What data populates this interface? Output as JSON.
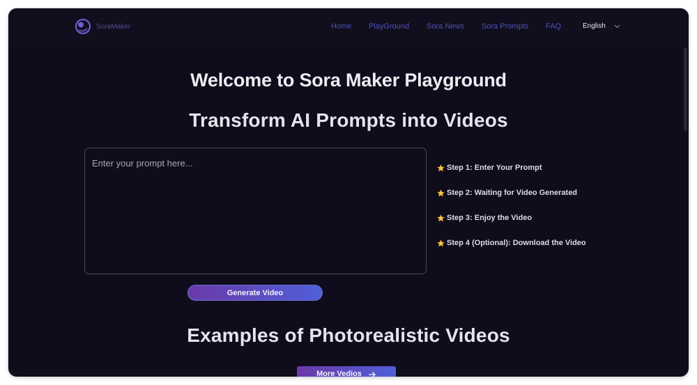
{
  "nav": {
    "logo_text": "SoraMaker",
    "links": [
      "Home",
      "PlayGround",
      "Sora News",
      "Sora Prompts",
      "FAQ"
    ],
    "language": "English"
  },
  "hero": {
    "title": "Welcome to Sora Maker Playground",
    "subtitle": "Transform AI Prompts into Videos"
  },
  "prompt": {
    "placeholder": "Enter your prompt here...",
    "generate_label": "Generate Video"
  },
  "steps": [
    "Step 1: Enter Your Prompt",
    "Step 2: Waiting for Video Generated",
    "Step 3: Enjoy the Video",
    "Step 4 (Optional): Download the Video"
  ],
  "examples": {
    "title": "Examples of Photorealistic Videos",
    "more_label": "More Vedios"
  },
  "icons": {
    "logo": "logo-icon",
    "language_dropdown": "chevron-down-icon",
    "step": "star-icon",
    "more": "arrow-right-icon"
  },
  "colors": {
    "background": "#0f0c1b",
    "nav_link": "#5050b8",
    "accent_start": "#6a3aa8",
    "accent_end": "#4f5fd8",
    "star": "#f4c542"
  }
}
